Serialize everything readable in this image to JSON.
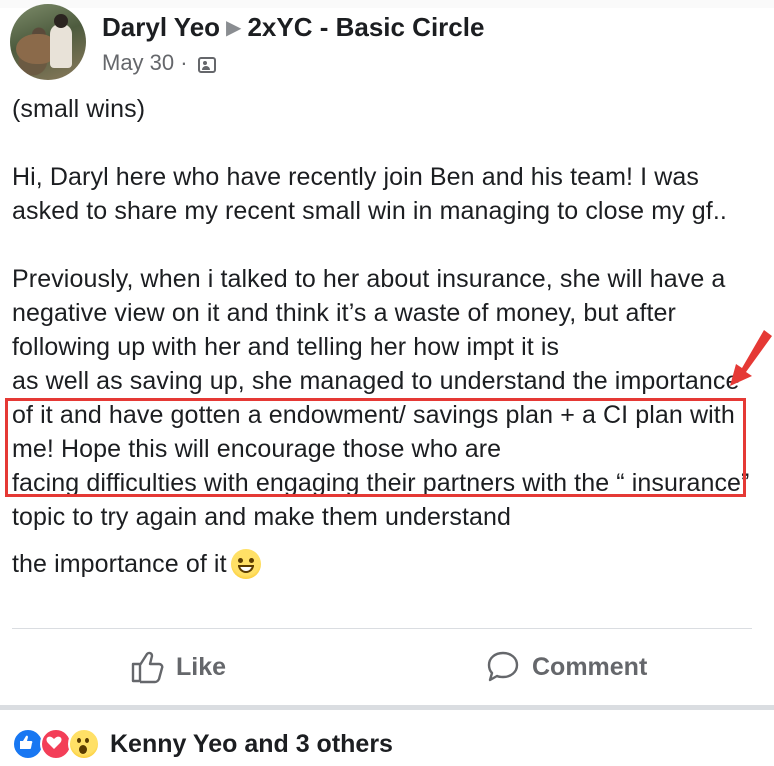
{
  "post": {
    "author": "Daryl Yeo",
    "group": "2xYC - Basic Circle",
    "date": "May 30 ·",
    "audience_icon": "group-audience-icon",
    "paragraphs": {
      "p1": "(small wins)",
      "p2": "Hi, Daryl here who have recently join Ben and his team! I was asked to share my recent small win in managing to close my gf..",
      "p3a": "Previously, when i talked to her about insurance, she will have a negative view on it and think it’s a waste of money, but after following up with her and telling her how impt it is",
      "p3b": "as well as saving up, she managed to understand the importance of it and have gotten a endowment/ savings plan + a CI plan with me! Hope this will encourage those who are",
      "p3c": "facing difficulties with engaging their partners with the “ insurance” topic to try again and make them understand",
      "p3d": "the importance of it"
    },
    "emoji": "grinning-face-emoji"
  },
  "actions": {
    "like_label": "Like",
    "comment_label": "Comment"
  },
  "reactions": {
    "icons": [
      "like-reaction-icon",
      "love-reaction-icon",
      "wow-reaction-icon"
    ],
    "summary": "Kenny Yeo and 3 others"
  },
  "colors": {
    "highlight_box": "#e53935",
    "annotation_arrow": "#e53935",
    "secondary_text": "#65676b"
  }
}
